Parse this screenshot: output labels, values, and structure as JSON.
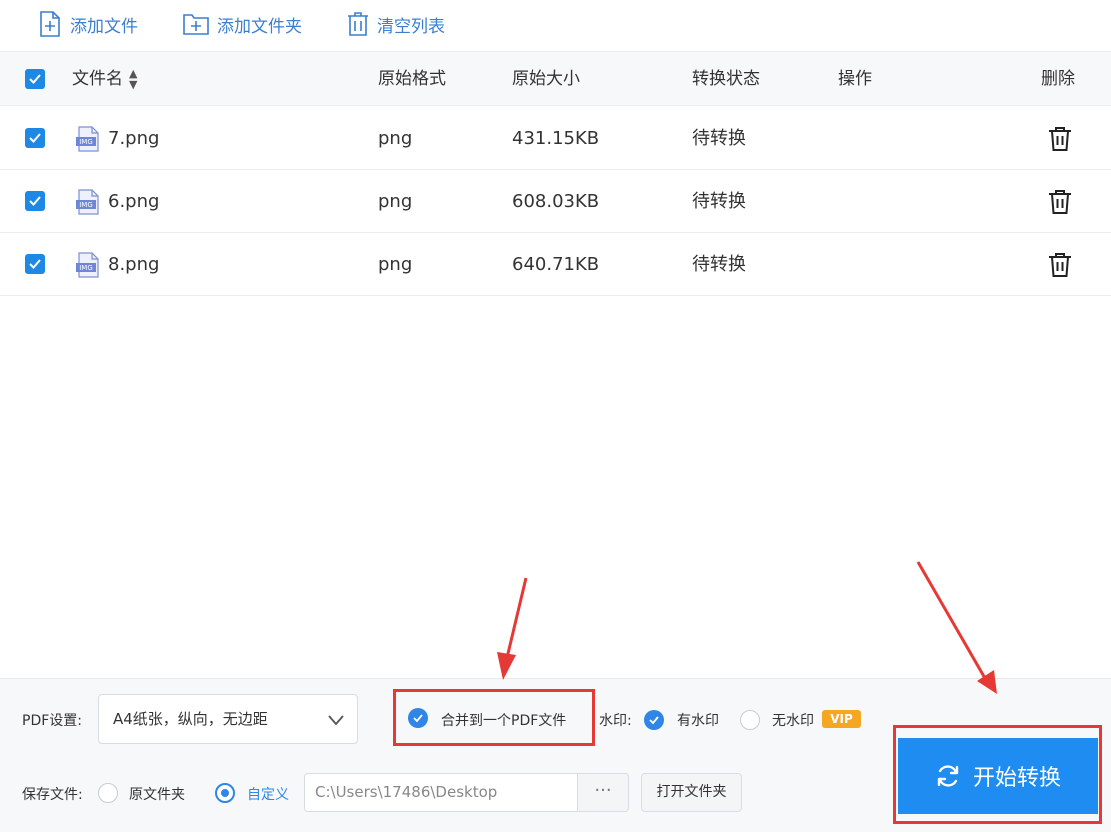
{
  "toolbar": {
    "add_file": "添加文件",
    "add_folder": "添加文件夹",
    "clear_list": "清空列表"
  },
  "table": {
    "headers": {
      "filename": "文件名",
      "format": "原始格式",
      "size": "原始大小",
      "status": "转换状态",
      "action": "操作",
      "delete": "删除"
    },
    "rows": [
      {
        "name": "7.png",
        "format": "png",
        "size": "431.15KB",
        "status": "待转换",
        "icon_label": "IMG"
      },
      {
        "name": "6.png",
        "format": "png",
        "size": "608.03KB",
        "status": "待转换",
        "icon_label": "IMG"
      },
      {
        "name": "8.png",
        "format": "png",
        "size": "640.71KB",
        "status": "待转换",
        "icon_label": "IMG"
      }
    ]
  },
  "settings": {
    "pdf_label": "PDF设置:",
    "pdf_value": "A4纸张，纵向，无边距",
    "merge_label": "合并到一个PDF文件",
    "watermark_label": "水印:",
    "with_watermark": "有水印",
    "no_watermark": "无水印",
    "vip": "VIP",
    "save_label": "保存文件:",
    "original_folder": "原文件夹",
    "custom": "自定义",
    "path": "C:\\Users\\17486\\Desktop",
    "dots": "···",
    "open_folder": "打开文件夹"
  },
  "start_button": "开始转换",
  "colors": {
    "accent": "#1e8cf0",
    "highlight": "#e53935",
    "link": "#3a7fd1",
    "vip": "#f5a623"
  }
}
